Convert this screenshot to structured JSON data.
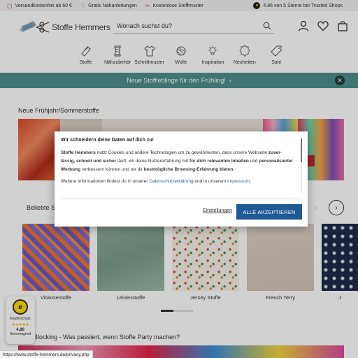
{
  "topbar": {
    "usps": [
      {
        "icon": "box-icon",
        "text": "Versandkostenfrei ab 60 €"
      },
      {
        "icon": "heart-icon",
        "text": "Gratis Nähanleitungen"
      },
      {
        "icon": "sewing-pattern-icon",
        "text": "Kostenlose Stoffmuster"
      }
    ],
    "trusted_text": "4.86 von 5 Sterne bei Trusted Shops",
    "trusted_badge": "e"
  },
  "header": {
    "logo_text": "Stoffe Hemmers",
    "search_placeholder": "Wonach suchst du?"
  },
  "categories": [
    {
      "label": "Stoffe",
      "icon": "fabric-roll-icon"
    },
    {
      "label": "Nähzubehör",
      "icon": "thread-spool-icon"
    },
    {
      "label": "Schnittmuster",
      "icon": "shirt-pattern-icon"
    },
    {
      "label": "Wolle",
      "icon": "yarn-ball-icon"
    },
    {
      "label": "Inspiration",
      "icon": "lightbulb-icon"
    },
    {
      "label": "Neuheiten",
      "icon": "new-badge-icon"
    },
    {
      "label": "Sale",
      "icon": "price-tag-icon"
    }
  ],
  "promo": {
    "text": "Neue Stoffieblinge für den Frühling!",
    "arrow": "›",
    "close": "✕"
  },
  "section_title": "Neue Frühjahr/Sommerstoffe",
  "popular": {
    "title": "Beliebte S",
    "prev": "‹",
    "next": "›",
    "tiles": [
      {
        "label": "Viskosestoffe"
      },
      {
        "label": "Leinenstoffe"
      },
      {
        "label": "Jersey Stoffe"
      },
      {
        "label": "French Terry"
      },
      {
        "label": "J"
      }
    ]
  },
  "blocking_title": "Blocking - Was passiert, wenn Stoffe Party machen?",
  "trust_badge": {
    "seal": "e",
    "label": "Käuferschutz",
    "stars": "★★★★★",
    "score": "4,86",
    "rating": "Hervorragend"
  },
  "statusbar_url": "https://www.stoffe-hemmers.de/privacy.php",
  "cookie": {
    "title": "Wir schneidern deine Daten auf dich zu!",
    "p_company": "Stoffe Hemmers",
    "p_1": " nutzt Cookies und andere Technologien um zu gewährleisten, dass unsere Webseite ",
    "p_b1": "zuver­lässig, schnell und sicher",
    "p_2": " läuft; wir deine Nutzererfahrung mit ",
    "p_b2": "für dich relevanten Inhalten",
    "p_3": " und ",
    "p_b3": "personali­sierter Werbung",
    "p_4": " verbessern können und wir dir ",
    "p_b4": "bestmögliche Browsing-Erfahrung bieten",
    "p_5": ".",
    "more_1": "Weitere Informationen findest du in unserer ",
    "link_privacy": "Datenschutzerklärung",
    "more_2": " und in unserem ",
    "link_imprint": "Impressum",
    "more_3": ".",
    "settings_label": "Einstellungen",
    "accept_label": "ALLE AKZEPTIEREN"
  },
  "colors": {
    "promo_bg": "#4e8e8a",
    "accept_bg": "#1e5a96",
    "accent": "#c0397a"
  }
}
